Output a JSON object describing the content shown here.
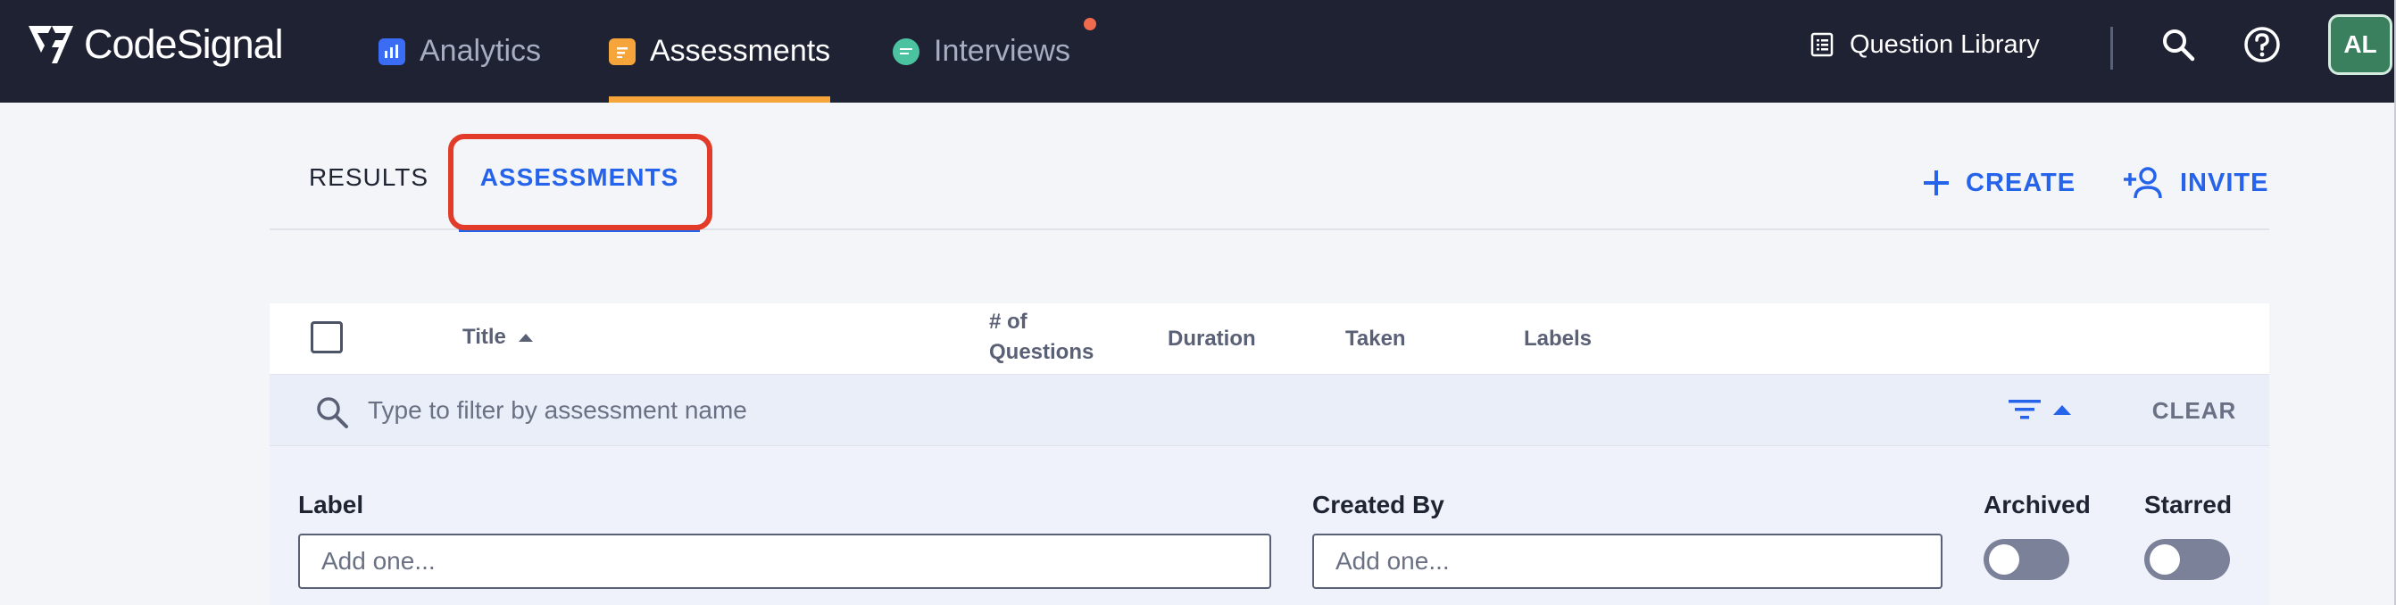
{
  "brand": {
    "name": "CodeSignal"
  },
  "nav": {
    "items": [
      {
        "label": "Analytics",
        "icon": "bar-chart-icon"
      },
      {
        "label": "Assessments",
        "icon": "document-icon",
        "active": true
      },
      {
        "label": "Interviews",
        "icon": "chat-bubble-icon",
        "notification": true
      }
    ],
    "question_library": "Question Library",
    "search_icon": "search-icon",
    "help_icon": "help-icon",
    "avatar_initials": "AL"
  },
  "tabs": {
    "results": "RESULTS",
    "assessments": "ASSESSMENTS"
  },
  "actions": {
    "create": "CREATE",
    "invite": "INVITE"
  },
  "table": {
    "headers": {
      "title": "Title",
      "questions_line1": "# of",
      "questions_line2": "Questions",
      "duration": "Duration",
      "taken": "Taken",
      "labels": "Labels"
    },
    "filter_placeholder": "Type to filter by assessment name",
    "clear": "CLEAR"
  },
  "filters": {
    "label": {
      "title": "Label",
      "placeholder": "Add one..."
    },
    "created_by": {
      "title": "Created By",
      "placeholder": "Add one..."
    },
    "archived": {
      "title": "Archived",
      "on": false
    },
    "starred": {
      "title": "Starred",
      "on": false
    }
  },
  "colors": {
    "nav_bg": "#1e2233",
    "accent_blue": "#2563eb",
    "active_underline": "#f6a53a",
    "highlight": "#e23b2a",
    "avatar_bg": "#3a7f5e"
  }
}
